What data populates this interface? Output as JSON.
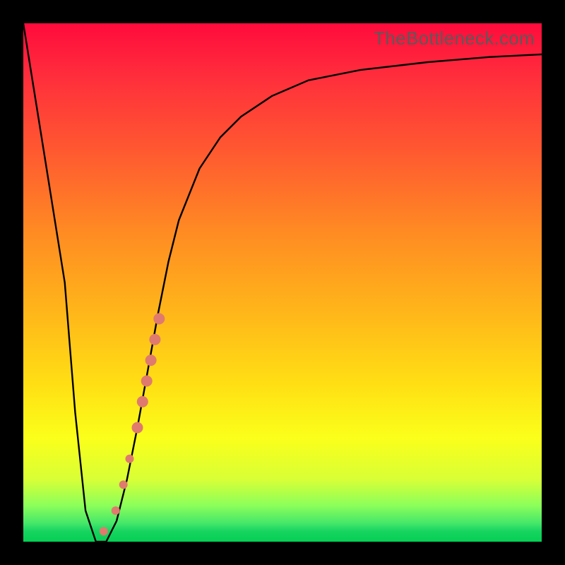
{
  "watermark": "TheBottleneck.com",
  "chart_data": {
    "type": "line",
    "title": "",
    "xlabel": "",
    "ylabel": "",
    "xlim": [
      0,
      100
    ],
    "ylim": [
      0,
      100
    ],
    "grid": false,
    "series": [
      {
        "name": "bottleneck-curve",
        "x": [
          0,
          4,
          8,
          10,
          12,
          14,
          16,
          18,
          20,
          22,
          24,
          26,
          28,
          30,
          34,
          38,
          42,
          48,
          55,
          65,
          78,
          90,
          100
        ],
        "y": [
          100,
          75,
          50,
          25,
          6,
          0,
          0,
          4,
          12,
          22,
          33,
          44,
          54,
          62,
          72,
          78,
          82,
          86,
          89,
          91,
          92.5,
          93.5,
          94
        ]
      }
    ],
    "markers": {
      "name": "highlight-points",
      "color": "#e07a6e",
      "points": [
        {
          "x": 15.5,
          "y": 2,
          "r": 6
        },
        {
          "x": 17.8,
          "y": 6,
          "r": 6
        },
        {
          "x": 19.3,
          "y": 11,
          "r": 6
        },
        {
          "x": 20.5,
          "y": 16,
          "r": 6
        },
        {
          "x": 22.0,
          "y": 22,
          "r": 8
        },
        {
          "x": 23.0,
          "y": 27,
          "r": 8
        },
        {
          "x": 23.8,
          "y": 31,
          "r": 8
        },
        {
          "x": 24.6,
          "y": 35,
          "r": 8
        },
        {
          "x": 25.4,
          "y": 39,
          "r": 8
        },
        {
          "x": 26.2,
          "y": 43,
          "r": 8
        }
      ]
    }
  }
}
